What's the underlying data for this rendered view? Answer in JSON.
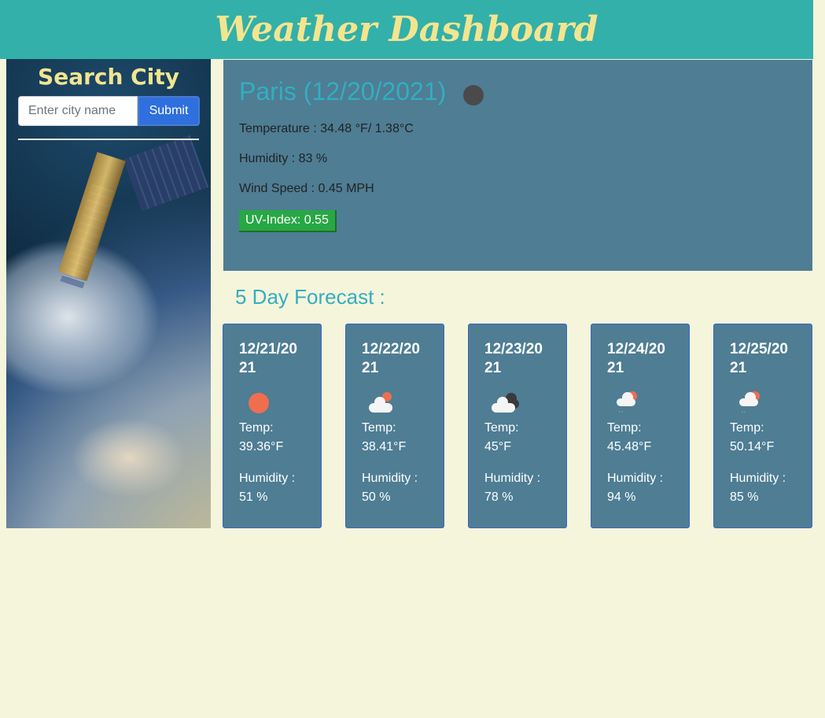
{
  "header": {
    "title": "Weather Dashboard"
  },
  "sidebar": {
    "title": "Search City",
    "search_placeholder": "Enter city name",
    "submit_label": "Submit"
  },
  "current": {
    "title": "Paris (12/20/2021)",
    "icon": "moon-icon",
    "temperature": "Temperature : 34.48 °F/ 1.38°C",
    "humidity": "Humidity : 83 %",
    "wind": "Wind Speed : 0.45 MPH",
    "uv": "UV-Index: 0.55"
  },
  "forecast": {
    "title": "5 Day Forecast :",
    "days": [
      {
        "date": "12/21/2021",
        "icon": "sun-icon",
        "temp_label": "Temp:",
        "temp": "39.36°F",
        "hum_label": "Humidity :",
        "humidity": "51 %"
      },
      {
        "date": "12/22/2021",
        "icon": "partly-cloudy-icon",
        "temp_label": "Temp:",
        "temp": "38.41°F",
        "hum_label": "Humidity :",
        "humidity": "50 %"
      },
      {
        "date": "12/23/2021",
        "icon": "clouds-icon",
        "temp_label": "Temp:",
        "temp": "45°F",
        "hum_label": "Humidity :",
        "humidity": "78 %"
      },
      {
        "date": "12/24/2021",
        "icon": "rain-icon",
        "temp_label": "Temp:",
        "temp": "45.48°F",
        "hum_label": "Humidity :",
        "humidity": "94 %"
      },
      {
        "date": "12/25/2021",
        "icon": "rain-icon",
        "temp_label": "Temp:",
        "temp": "50.14°F",
        "hum_label": "Humidity :",
        "humidity": "85 %"
      }
    ]
  },
  "colors": {
    "header_bg": "#33b0aa",
    "title_yellow": "#f3e58f",
    "panel_bg": "#4e7d94",
    "accent_teal": "#33aec0",
    "uv_green": "#28a745",
    "page_bg": "#f5f5dc"
  }
}
